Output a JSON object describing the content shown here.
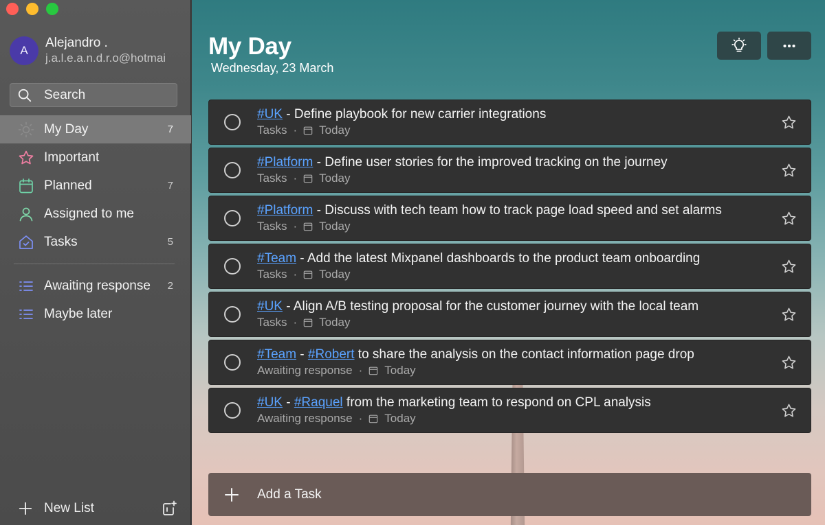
{
  "colors": {
    "tag_link": "#5aa2ff",
    "avatar_bg": "#4a3aa8",
    "my_day_icon": "#8a8a8a",
    "important_icon": "#f07fa3",
    "planned_icon": "#6fd0a6",
    "assigned_icon": "#7ed6a8",
    "tasks_icon": "#7d8ff5",
    "list_icon": "#7d8ff5"
  },
  "account": {
    "avatar_initial": "A",
    "name": "Alejandro .",
    "email": "j.a.l.e.a.n.d.r.o@hotmai"
  },
  "search": {
    "label": "Search",
    "icon": "search-icon"
  },
  "sidebar": {
    "smart_lists": [
      {
        "id": "my-day",
        "label": "My Day",
        "count": "7",
        "icon": "sun-icon",
        "active": true
      },
      {
        "id": "important",
        "label": "Important",
        "count": "",
        "icon": "star-icon"
      },
      {
        "id": "planned",
        "label": "Planned",
        "count": "7",
        "icon": "calendar-icon"
      },
      {
        "id": "assigned",
        "label": "Assigned to me",
        "count": "",
        "icon": "person-icon"
      },
      {
        "id": "tasks",
        "label": "Tasks",
        "count": "5",
        "icon": "home-icon"
      }
    ],
    "lists": [
      {
        "id": "awaiting",
        "label": "Awaiting response",
        "count": "2",
        "icon": "list-icon"
      },
      {
        "id": "maybe-later",
        "label": "Maybe later",
        "count": "",
        "icon": "list-icon"
      }
    ],
    "new_list_label": "New List"
  },
  "main": {
    "title": "My Day",
    "date": "Wednesday, 23 March",
    "tasks": [
      {
        "title": [
          {
            "tag": "#UK"
          },
          {
            "text": " - Define playbook for new carrier integrations"
          }
        ],
        "list": "Tasks",
        "due": "Today"
      },
      {
        "title": [
          {
            "tag": "#Platform"
          },
          {
            "text": " - Define user stories for the improved tracking on the journey"
          }
        ],
        "list": "Tasks",
        "due": "Today"
      },
      {
        "title": [
          {
            "tag": "#Platform"
          },
          {
            "text": " - Discuss with tech team how to track page load speed and set alarms"
          }
        ],
        "list": "Tasks",
        "due": "Today"
      },
      {
        "title": [
          {
            "tag": "#Team"
          },
          {
            "text": " - Add the latest Mixpanel dashboards to the product team onboarding"
          }
        ],
        "list": "Tasks",
        "due": "Today"
      },
      {
        "title": [
          {
            "tag": "#UK"
          },
          {
            "text": " - Align A/B testing proposal for the customer journey with the local team"
          }
        ],
        "list": "Tasks",
        "due": "Today"
      },
      {
        "title": [
          {
            "tag": "#Team"
          },
          {
            "text": " - "
          },
          {
            "tag": "#Robert"
          },
          {
            "text": " to share the analysis on the contact information page drop"
          }
        ],
        "list": "Awaiting response",
        "due": "Today"
      },
      {
        "title": [
          {
            "tag": "#UK"
          },
          {
            "text": " - "
          },
          {
            "tag": "#Raquel"
          },
          {
            "text": " from the marketing team to respond on CPL analysis"
          }
        ],
        "list": "Awaiting response",
        "due": "Today"
      }
    ],
    "add_task_label": "Add a Task"
  }
}
